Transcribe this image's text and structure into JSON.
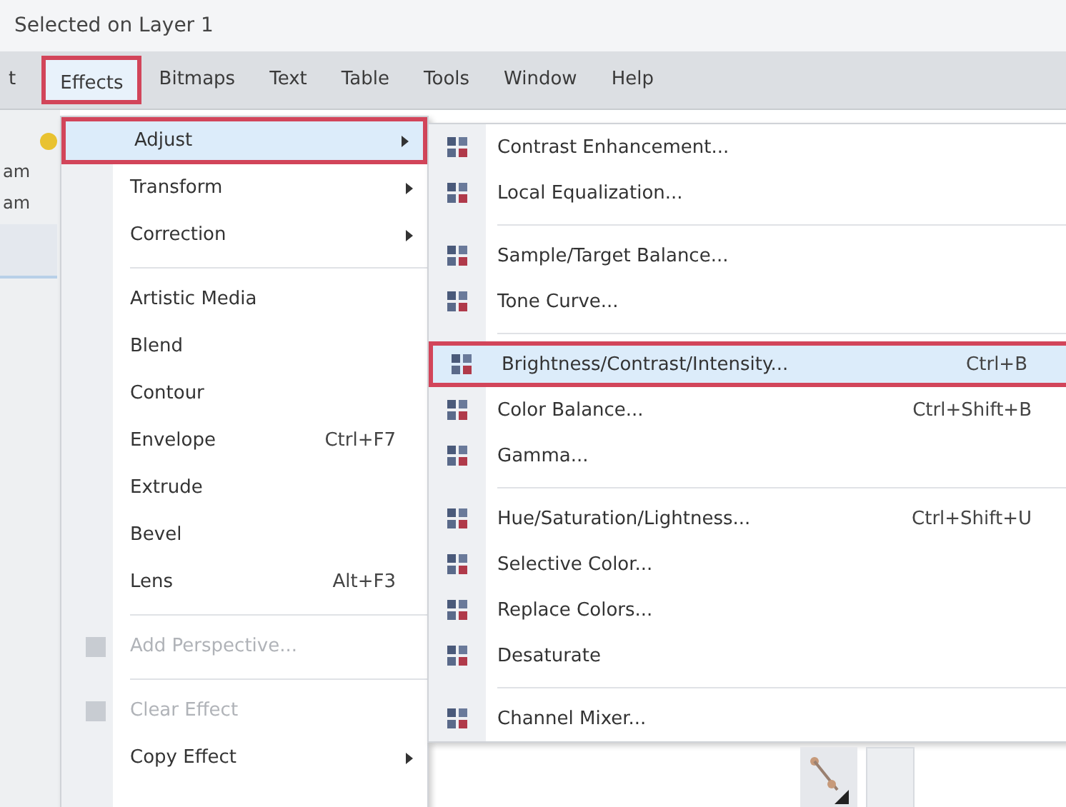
{
  "status": {
    "text": "Selected on Layer 1"
  },
  "menubar": [
    {
      "label": "t",
      "selected": false
    },
    {
      "label": "Effects",
      "selected": true
    },
    {
      "label": "Bitmaps",
      "selected": false
    },
    {
      "label": "Text",
      "selected": false
    },
    {
      "label": "Table",
      "selected": false
    },
    {
      "label": "Tools",
      "selected": false
    },
    {
      "label": "Window",
      "selected": false
    },
    {
      "label": "Help",
      "selected": false
    }
  ],
  "toolbar_fragments": [
    "am",
    "am"
  ],
  "effects_menu": [
    {
      "kind": "item",
      "label": "Adjust",
      "highlighted": true,
      "disabled": false,
      "submenu": true
    },
    {
      "kind": "item",
      "label": "Transform",
      "highlighted": false,
      "disabled": false,
      "submenu": true
    },
    {
      "kind": "item",
      "label": "Correction",
      "highlighted": false,
      "disabled": false,
      "submenu": true
    },
    {
      "kind": "separator"
    },
    {
      "kind": "item",
      "label": "Artistic Media",
      "highlighted": false,
      "disabled": false,
      "submenu": false
    },
    {
      "kind": "item",
      "label": "Blend",
      "highlighted": false,
      "disabled": false,
      "submenu": false
    },
    {
      "kind": "item",
      "label": "Contour",
      "highlighted": false,
      "disabled": false,
      "submenu": false
    },
    {
      "kind": "item",
      "label": "Envelope",
      "shortcut": "Ctrl+F7",
      "highlighted": false,
      "disabled": false,
      "submenu": false
    },
    {
      "kind": "item",
      "label": "Extrude",
      "highlighted": false,
      "disabled": false,
      "submenu": false
    },
    {
      "kind": "item",
      "label": "Bevel",
      "highlighted": false,
      "disabled": false,
      "submenu": false
    },
    {
      "kind": "item",
      "label": "Lens",
      "shortcut": "Alt+F3",
      "highlighted": false,
      "disabled": false,
      "submenu": false
    },
    {
      "kind": "separator"
    },
    {
      "kind": "item",
      "label": "Add Perspective...",
      "highlighted": false,
      "disabled": true,
      "submenu": false,
      "icon": true
    },
    {
      "kind": "separator"
    },
    {
      "kind": "item",
      "label": "Clear Effect",
      "highlighted": false,
      "disabled": true,
      "submenu": false,
      "icon": true
    },
    {
      "kind": "item",
      "label": "Copy Effect",
      "highlighted": false,
      "disabled": false,
      "submenu": true
    }
  ],
  "adjust_submenu": [
    {
      "kind": "item",
      "label": "Contrast Enhancement...",
      "highlighted": false
    },
    {
      "kind": "item",
      "label": "Local Equalization...",
      "highlighted": false
    },
    {
      "kind": "separator"
    },
    {
      "kind": "item",
      "label": "Sample/Target Balance...",
      "highlighted": false
    },
    {
      "kind": "item",
      "label": "Tone Curve...",
      "highlighted": false
    },
    {
      "kind": "separator"
    },
    {
      "kind": "item",
      "label": "Brightness/Contrast/Intensity...",
      "shortcut": "Ctrl+B",
      "highlighted": true
    },
    {
      "kind": "item",
      "label": "Color Balance...",
      "shortcut": "Ctrl+Shift+B",
      "highlighted": false
    },
    {
      "kind": "item",
      "label": "Gamma...",
      "highlighted": false
    },
    {
      "kind": "separator"
    },
    {
      "kind": "item",
      "label": "Hue/Saturation/Lightness...",
      "shortcut": "Ctrl+Shift+U",
      "highlighted": false
    },
    {
      "kind": "item",
      "label": "Selective Color...",
      "highlighted": false
    },
    {
      "kind": "item",
      "label": "Replace Colors...",
      "highlighted": false
    },
    {
      "kind": "item",
      "label": "Desaturate",
      "highlighted": false
    },
    {
      "kind": "separator"
    },
    {
      "kind": "item",
      "label": "Channel Mixer...",
      "highlighted": false
    }
  ]
}
